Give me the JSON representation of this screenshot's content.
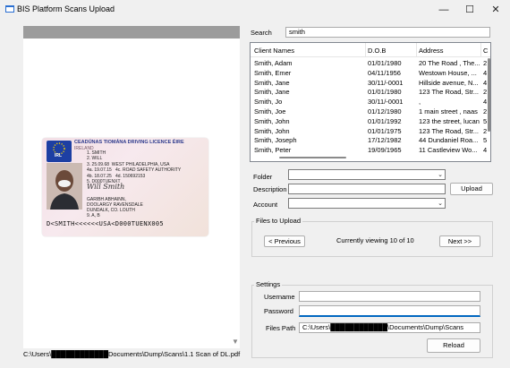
{
  "window": {
    "title": "BIS Platform Scans Upload",
    "min": "—",
    "max": "☐",
    "close": "✕"
  },
  "preview": {
    "path": "C:\\Users\\████████████Documents\\Dump\\Scans\\1.1 Scan of DL.pdf",
    "scroll_down": "▼"
  },
  "license": {
    "header_line1": "CEADÚNAS TIOMÁNA  DRIVING LICENCE  ÉIRE",
    "header_line2": "IRELAND",
    "flag_text": "IRL",
    "fields": "1. SMITH\n2. WILL\n3. 25.09.68  WEST PHILADELPHIA, USA\n4a. 19.07.15   4c. ROAD SAFETY AUTHORITY\n4b. 18.07.25   4d. 150692153\n5. D000TUENXT",
    "signature": "Will Smith",
    "address": "GARIBH ABHAINN,\nDOOLARGY RAVENSDALE\nDUNDALK, CO. LOUTH\n9. A, B",
    "mrz": "D<SMITH<<<<<<USA<D000TUENX005"
  },
  "search": {
    "label": "Search",
    "value": "smith"
  },
  "grid": {
    "headers": [
      "Client Names",
      "D.O.B",
      "Address",
      "C"
    ],
    "rows": [
      [
        "Smith, Adam",
        "01/01/1980",
        "20 The Road , The...",
        "2"
      ],
      [
        "Smith, Emer",
        "04/11/1956",
        "Westown House, ...",
        "4"
      ],
      [
        "Smith, Jane",
        "30/11/-0001",
        "Hillside avenue, N...",
        "4"
      ],
      [
        "Smith, Jane",
        "01/01/1980",
        "123 The Road, Str...",
        "2"
      ],
      [
        "Smith, Jo",
        "30/11/-0001",
        ",",
        "4"
      ],
      [
        "Smith, Joe",
        "01/12/1980",
        "1 main street , naas",
        "2"
      ],
      [
        "Smith, John",
        "01/01/1992",
        "123 the street, lucan",
        "5"
      ],
      [
        "Smith, John",
        "01/01/1975",
        "123 The Road, Str...",
        "2"
      ],
      [
        "Smith, Joseph",
        "17/12/1982",
        "44 Dundaniel Roa...",
        "5"
      ],
      [
        "Smith, Peter",
        "19/09/1965",
        "11 Castleview Wo...",
        "4"
      ]
    ]
  },
  "form": {
    "folder_label": "Folder",
    "description_label": "Description",
    "account_label": "Account",
    "upload_button": "Upload"
  },
  "files_to_upload": {
    "title": "Files to Upload",
    "previous": "< Previous",
    "status": "Currently viewing 10 of 10",
    "next": "Next >>"
  },
  "settings": {
    "title": "Settings",
    "username_label": "Username",
    "password_label": "Password",
    "files_path_label": "Files Path",
    "files_path_value": "C:\\Users\\████████████\\Documents\\Dump\\Scans",
    "reload_button": "Reload"
  }
}
